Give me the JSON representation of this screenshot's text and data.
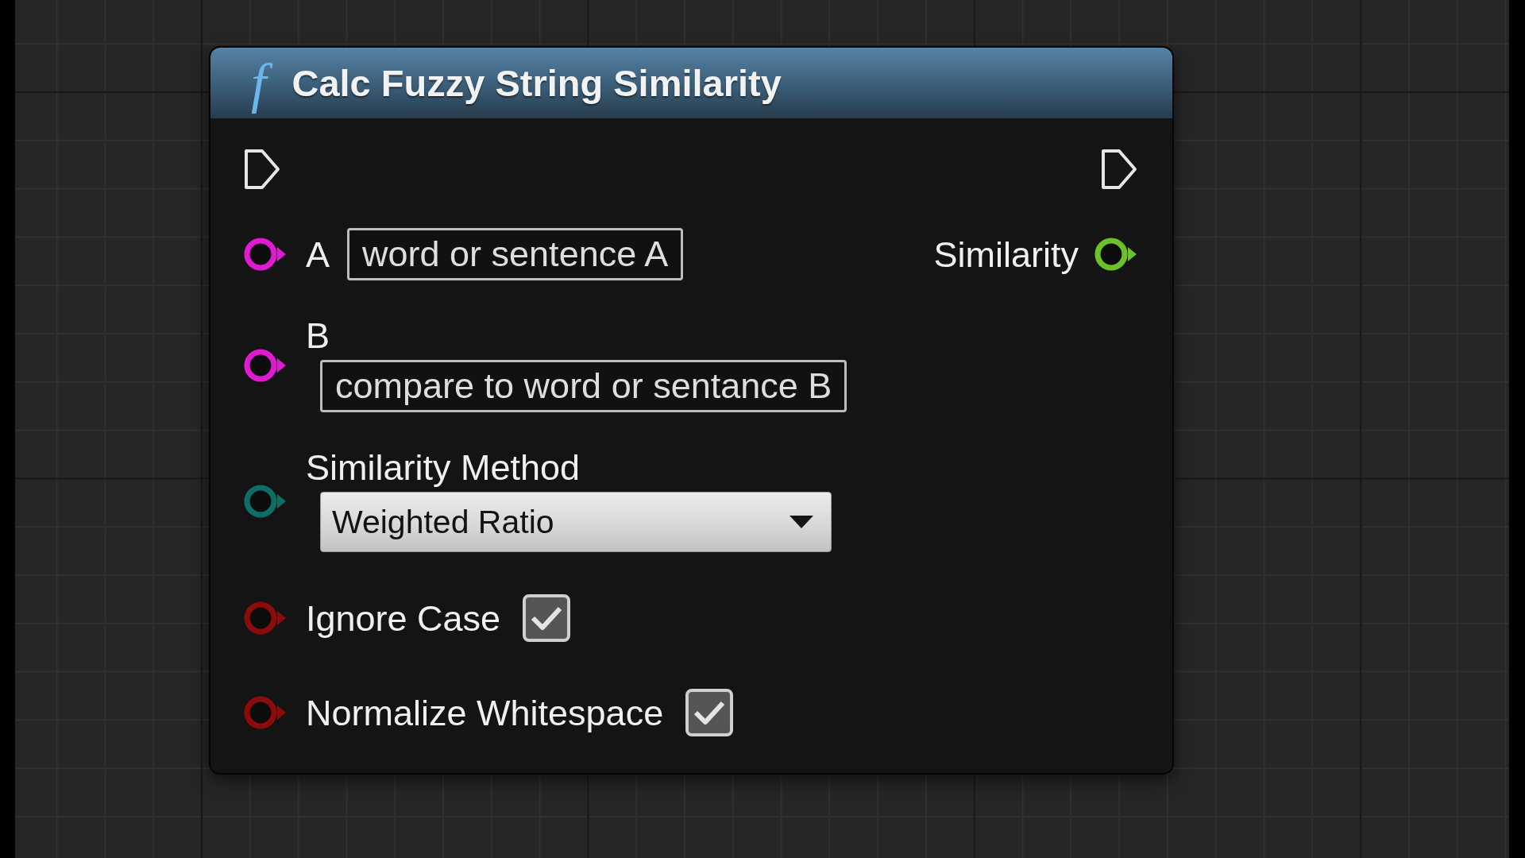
{
  "node": {
    "icon": "f",
    "title": "Calc Fuzzy String Similarity",
    "exec_in": {
      "connected": false
    },
    "exec_out": {
      "connected": false
    },
    "inputs": [
      {
        "name": "A",
        "kind": "text",
        "color": "#e01ad0",
        "connected": false,
        "stacked": false,
        "value": "word or sentence A"
      },
      {
        "name": "B",
        "kind": "text",
        "color": "#e01ad0",
        "connected": false,
        "stacked": true,
        "value": "compare to word or sentance B"
      },
      {
        "name": "Similarity Method",
        "kind": "enum",
        "color": "#0d6e66",
        "connected": false,
        "stacked": true,
        "value": "Weighted Ratio"
      },
      {
        "name": "Ignore Case",
        "kind": "bool",
        "color": "#8c0b0b",
        "connected": false,
        "stacked": false,
        "checked": true
      },
      {
        "name": "Normalize Whitespace",
        "kind": "bool",
        "color": "#8c0b0b",
        "connected": false,
        "stacked": false,
        "checked": true
      }
    ],
    "outputs": [
      {
        "name": "Similarity",
        "color": "#6cc02a",
        "connected": false
      }
    ]
  }
}
